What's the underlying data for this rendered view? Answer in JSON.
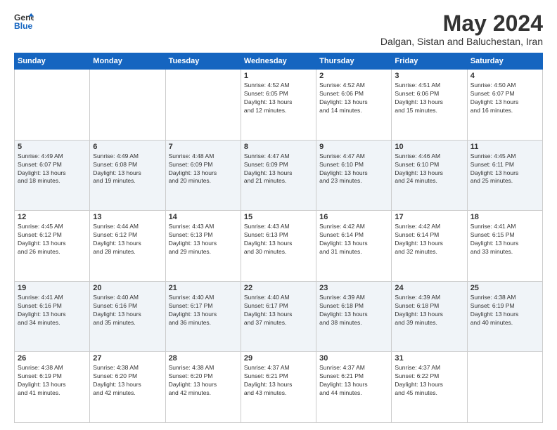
{
  "logo": {
    "line1": "General",
    "line2": "Blue"
  },
  "title": "May 2024",
  "subtitle": "Dalgan, Sistan and Baluchestan, Iran",
  "days_of_week": [
    "Sunday",
    "Monday",
    "Tuesday",
    "Wednesday",
    "Thursday",
    "Friday",
    "Saturday"
  ],
  "weeks": [
    [
      {
        "day": "",
        "info": ""
      },
      {
        "day": "",
        "info": ""
      },
      {
        "day": "",
        "info": ""
      },
      {
        "day": "1",
        "info": "Sunrise: 4:52 AM\nSunset: 6:05 PM\nDaylight: 13 hours\nand 12 minutes."
      },
      {
        "day": "2",
        "info": "Sunrise: 4:52 AM\nSunset: 6:06 PM\nDaylight: 13 hours\nand 14 minutes."
      },
      {
        "day": "3",
        "info": "Sunrise: 4:51 AM\nSunset: 6:06 PM\nDaylight: 13 hours\nand 15 minutes."
      },
      {
        "day": "4",
        "info": "Sunrise: 4:50 AM\nSunset: 6:07 PM\nDaylight: 13 hours\nand 16 minutes."
      }
    ],
    [
      {
        "day": "5",
        "info": "Sunrise: 4:49 AM\nSunset: 6:07 PM\nDaylight: 13 hours\nand 18 minutes."
      },
      {
        "day": "6",
        "info": "Sunrise: 4:49 AM\nSunset: 6:08 PM\nDaylight: 13 hours\nand 19 minutes."
      },
      {
        "day": "7",
        "info": "Sunrise: 4:48 AM\nSunset: 6:09 PM\nDaylight: 13 hours\nand 20 minutes."
      },
      {
        "day": "8",
        "info": "Sunrise: 4:47 AM\nSunset: 6:09 PM\nDaylight: 13 hours\nand 21 minutes."
      },
      {
        "day": "9",
        "info": "Sunrise: 4:47 AM\nSunset: 6:10 PM\nDaylight: 13 hours\nand 23 minutes."
      },
      {
        "day": "10",
        "info": "Sunrise: 4:46 AM\nSunset: 6:10 PM\nDaylight: 13 hours\nand 24 minutes."
      },
      {
        "day": "11",
        "info": "Sunrise: 4:45 AM\nSunset: 6:11 PM\nDaylight: 13 hours\nand 25 minutes."
      }
    ],
    [
      {
        "day": "12",
        "info": "Sunrise: 4:45 AM\nSunset: 6:12 PM\nDaylight: 13 hours\nand 26 minutes."
      },
      {
        "day": "13",
        "info": "Sunrise: 4:44 AM\nSunset: 6:12 PM\nDaylight: 13 hours\nand 28 minutes."
      },
      {
        "day": "14",
        "info": "Sunrise: 4:43 AM\nSunset: 6:13 PM\nDaylight: 13 hours\nand 29 minutes."
      },
      {
        "day": "15",
        "info": "Sunrise: 4:43 AM\nSunset: 6:13 PM\nDaylight: 13 hours\nand 30 minutes."
      },
      {
        "day": "16",
        "info": "Sunrise: 4:42 AM\nSunset: 6:14 PM\nDaylight: 13 hours\nand 31 minutes."
      },
      {
        "day": "17",
        "info": "Sunrise: 4:42 AM\nSunset: 6:14 PM\nDaylight: 13 hours\nand 32 minutes."
      },
      {
        "day": "18",
        "info": "Sunrise: 4:41 AM\nSunset: 6:15 PM\nDaylight: 13 hours\nand 33 minutes."
      }
    ],
    [
      {
        "day": "19",
        "info": "Sunrise: 4:41 AM\nSunset: 6:16 PM\nDaylight: 13 hours\nand 34 minutes."
      },
      {
        "day": "20",
        "info": "Sunrise: 4:40 AM\nSunset: 6:16 PM\nDaylight: 13 hours\nand 35 minutes."
      },
      {
        "day": "21",
        "info": "Sunrise: 4:40 AM\nSunset: 6:17 PM\nDaylight: 13 hours\nand 36 minutes."
      },
      {
        "day": "22",
        "info": "Sunrise: 4:40 AM\nSunset: 6:17 PM\nDaylight: 13 hours\nand 37 minutes."
      },
      {
        "day": "23",
        "info": "Sunrise: 4:39 AM\nSunset: 6:18 PM\nDaylight: 13 hours\nand 38 minutes."
      },
      {
        "day": "24",
        "info": "Sunrise: 4:39 AM\nSunset: 6:18 PM\nDaylight: 13 hours\nand 39 minutes."
      },
      {
        "day": "25",
        "info": "Sunrise: 4:38 AM\nSunset: 6:19 PM\nDaylight: 13 hours\nand 40 minutes."
      }
    ],
    [
      {
        "day": "26",
        "info": "Sunrise: 4:38 AM\nSunset: 6:19 PM\nDaylight: 13 hours\nand 41 minutes."
      },
      {
        "day": "27",
        "info": "Sunrise: 4:38 AM\nSunset: 6:20 PM\nDaylight: 13 hours\nand 42 minutes."
      },
      {
        "day": "28",
        "info": "Sunrise: 4:38 AM\nSunset: 6:20 PM\nDaylight: 13 hours\nand 42 minutes."
      },
      {
        "day": "29",
        "info": "Sunrise: 4:37 AM\nSunset: 6:21 PM\nDaylight: 13 hours\nand 43 minutes."
      },
      {
        "day": "30",
        "info": "Sunrise: 4:37 AM\nSunset: 6:21 PM\nDaylight: 13 hours\nand 44 minutes."
      },
      {
        "day": "31",
        "info": "Sunrise: 4:37 AM\nSunset: 6:22 PM\nDaylight: 13 hours\nand 45 minutes."
      },
      {
        "day": "",
        "info": ""
      }
    ]
  ]
}
